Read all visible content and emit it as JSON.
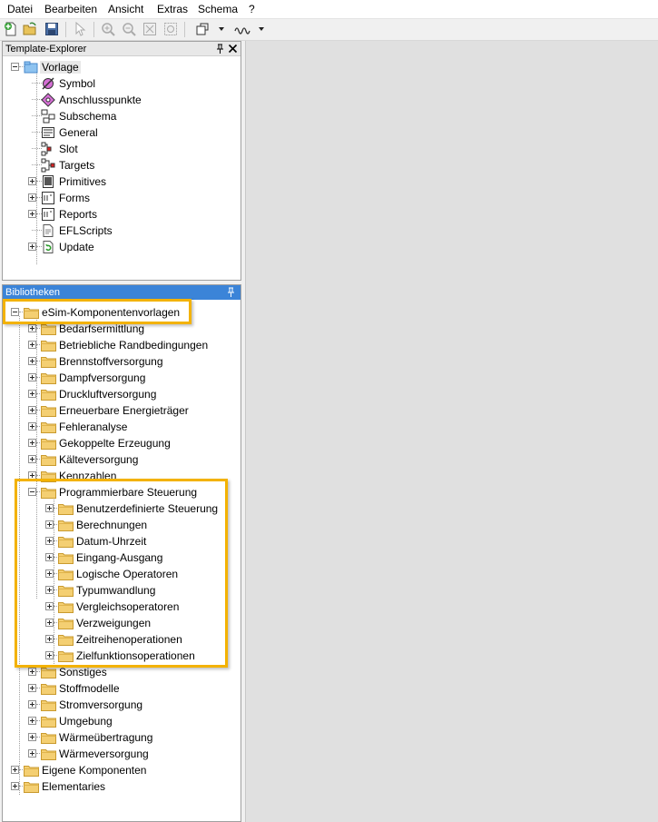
{
  "menubar": {
    "items": [
      "Datei",
      "Bearbeiten",
      "Ansicht",
      "Extras",
      "Schema",
      "?"
    ]
  },
  "template_explorer": {
    "title": "Template-Explorer",
    "root": "Vorlage",
    "items": [
      "Symbol",
      "Anschlusspunkte",
      "Subschema",
      "General",
      "Slot",
      "Targets",
      "Primitives",
      "Forms",
      "Reports",
      "EFLScripts",
      "Update"
    ]
  },
  "bibliotheken": {
    "title": "Bibliotheken",
    "root": "eSim-Komponentenvorlagen",
    "children": [
      "Bedarfsermittlung",
      "Betriebliche Randbedingungen",
      "Brennstoffversorgung",
      "Dampfversorgung",
      "Druckluftversorgung",
      "Erneuerbare Energieträger",
      "Fehleranalyse",
      "Gekoppelte Erzeugung",
      "Kälteversorgung",
      "Kennzahlen",
      "Programmierbare Steuerung",
      "Sonstiges",
      "Stoffmodelle",
      "Stromversorgung",
      "Umgebung",
      "Wärmeübertragung",
      "Wärmeversorgung"
    ],
    "steuerung_children": [
      "Benutzerdefinierte Steuerung",
      "Berechnungen",
      "Datum-Uhrzeit",
      "Eingang-Ausgang",
      "Logische Operatoren",
      "Typumwandlung",
      "Vergleichsoperatoren",
      "Verzweigungen",
      "Zeitreihenoperationen",
      "Zielfunktionsoperationen"
    ],
    "top_level": [
      "Eigene Komponenten",
      "Elementaries"
    ]
  },
  "colors": {
    "highlight": "#f3b200",
    "active_header": "#3b84d8",
    "folder": "#f4cf72"
  }
}
